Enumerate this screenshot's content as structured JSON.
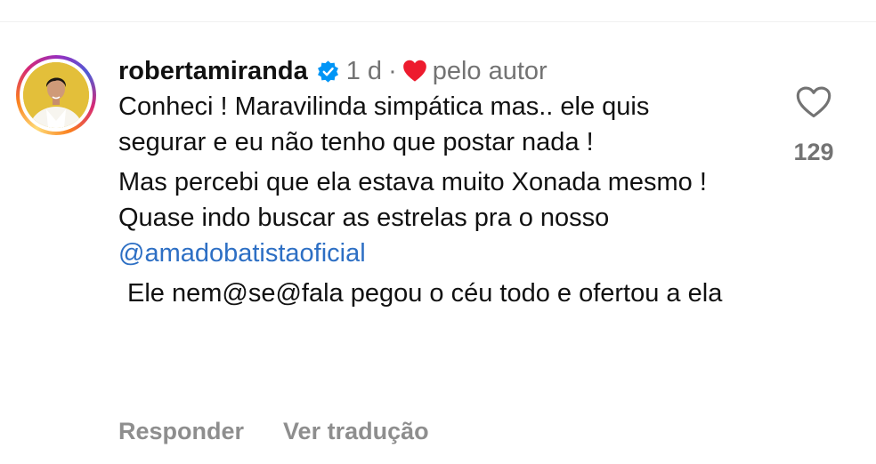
{
  "comment": {
    "username": "robertamiranda",
    "time": "1 d",
    "separator": "·",
    "liked_by_author": "pelo autor",
    "paragraphs": [
      {
        "text": "Conheci ! Maravilinda simpática mas.. ele quis segurar e eu não tenho que postar nada !"
      },
      {
        "text": "Mas percebi que ela estava muito Xonada mesmo ! Quase indo buscar as estrelas pra o nosso ",
        "mention": "@amadobatistaoficial"
      },
      {
        "text": "Ele nem@se@fala pegou o céu todo e ofertou a ela"
      }
    ]
  },
  "actions": {
    "reply": "Responder",
    "translate": "Ver tradução"
  },
  "likes": {
    "count": "129"
  },
  "icons": {
    "verified": "verified-badge-icon",
    "author_heart": "heart-filled-icon",
    "like": "heart-outline-icon"
  },
  "colors": {
    "verified_blue": "#0095f6",
    "heart_red": "#ed1b2e",
    "mention_blue": "#2d6fc4",
    "muted_gray": "#8e8e8e"
  }
}
